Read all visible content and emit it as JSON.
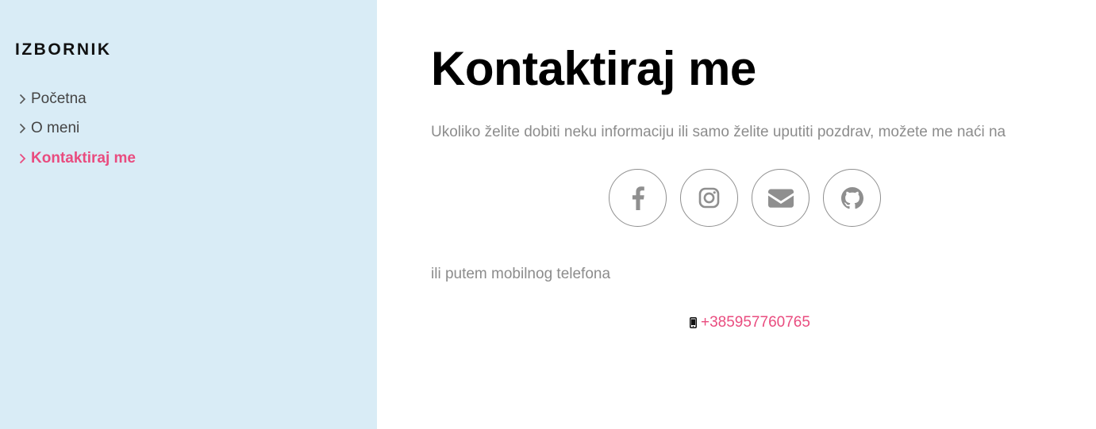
{
  "sidebar": {
    "title": "IZBORNIK",
    "items": [
      {
        "label": "Početna",
        "icon": "chevron-right-icon",
        "active": false
      },
      {
        "label": "O meni",
        "icon": "chevron-right-icon",
        "active": false
      },
      {
        "label": "Kontaktiraj me",
        "icon": "chevron-right-icon",
        "active": true
      }
    ],
    "background": "#d9ecf6",
    "active_color": "#e94c7f"
  },
  "main": {
    "title": "Kontaktiraj me",
    "intro": "Ukoliko želite dobiti neku informaciju ili samo želite uputiti pozdrav, možete me naći na",
    "socials": [
      {
        "name": "facebook",
        "icon": "facebook-icon"
      },
      {
        "name": "instagram",
        "icon": "instagram-icon"
      },
      {
        "name": "email",
        "icon": "envelope-icon"
      },
      {
        "name": "github",
        "icon": "github-icon"
      }
    ],
    "phone_intro": "ili putem mobilnog telefona",
    "phone": {
      "icon": "mobile-phone-icon",
      "number": "+385957760765"
    },
    "link_color": "#e94c7f",
    "text_color": "#8c8c8c"
  }
}
